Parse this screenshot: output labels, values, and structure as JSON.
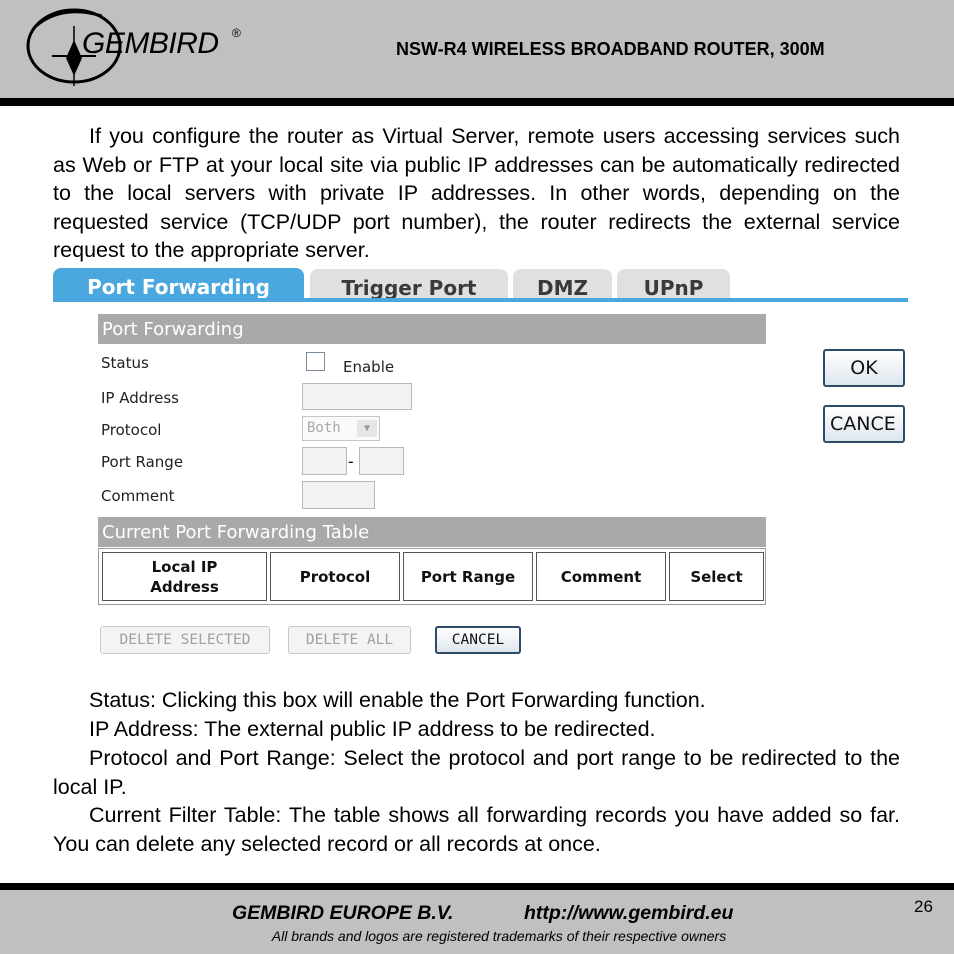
{
  "header": {
    "logo_text": "GEMBIRD",
    "logo_mark": "®",
    "title": "NSW-R4 WIRELESS BROADBAND ROUTER, 300M"
  },
  "intro": "If you configure the router as Virtual Server, remote users accessing services such as Web or FTP at your local site via public IP addresses can be automatically redirected to the local servers with private IP addresses. In other words, depending on the requested service (TCP/UDP port number), the router redirects the external service request to the appropriate server.",
  "ui": {
    "tabs": [
      "Port Forwarding",
      "Trigger Port",
      "DMZ",
      "UPnP"
    ],
    "section_title": "Port Forwarding",
    "labels": {
      "status": "Status",
      "ip_address": "IP Address",
      "protocol": "Protocol",
      "port_range": "Port Range",
      "comment": "Comment"
    },
    "enable_label": "Enable",
    "protocol_value": "Both",
    "port_dash": "-",
    "ok_button": "OK",
    "cancel_button": "CANCE",
    "table_title": "Current Port Forwarding Table",
    "table_headers": [
      "Local IP Address",
      "Protocol",
      "Port Range",
      "Comment",
      "Select"
    ],
    "delete_selected": "DELETE SELECTED",
    "delete_all": "DELETE ALL",
    "cancel_bottom": "CANCEL"
  },
  "descriptions": [
    "Status: Clicking this box will enable the Port Forwarding function.",
    "IP Address: The external public IP address to be redirected.",
    "Protocol and Port Range: Select the protocol and port range to be redirected to the local IP.",
    "Current Filter Table: The table shows all forwarding records you have added so far. You can delete any selected record or all records at once."
  ],
  "footer": {
    "company": "GEMBIRD EUROPE B.V.",
    "url": "http://www.gembird.eu",
    "note": "All brands and logos are registered trademarks of their respective owners",
    "page_number": "26"
  }
}
